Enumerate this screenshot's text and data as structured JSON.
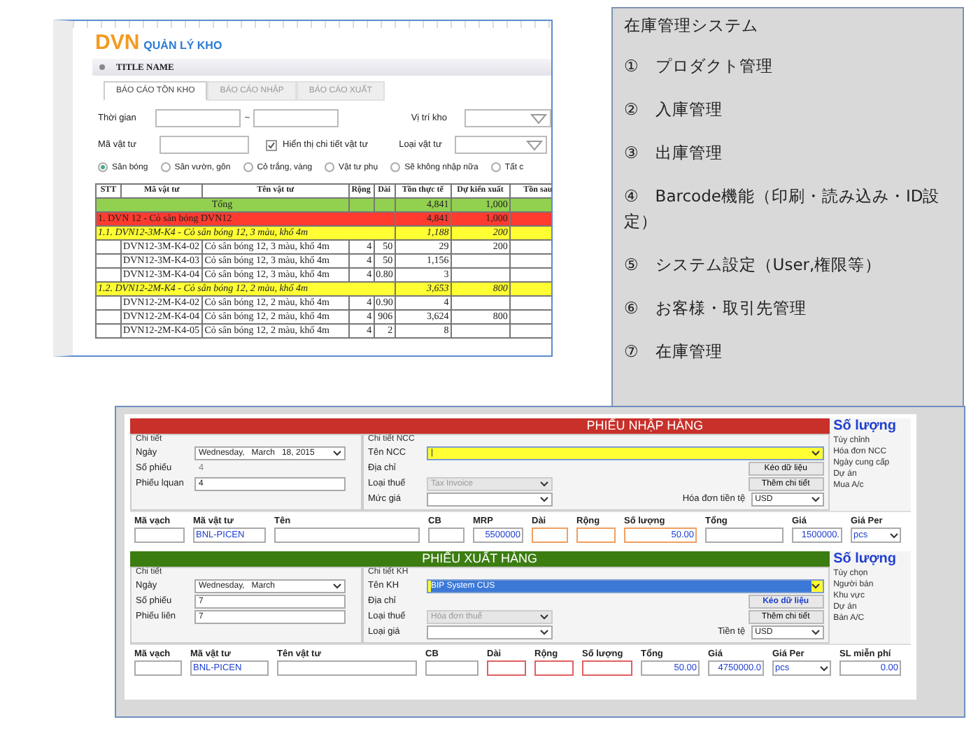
{
  "report_window": {
    "logo": {
      "brand": "DVN",
      "subtitle": "QUẢN LÝ KHO"
    },
    "title": "TITLE NAME",
    "tabs": [
      {
        "label": "BÁO CÁO TỒN KHO",
        "selected": true
      },
      {
        "label": "BÁO CÁO NHẬP",
        "selected": false
      },
      {
        "label": "BÁO CÁO XUẤT",
        "selected": false
      }
    ],
    "filters": {
      "time_label": "Thời gian",
      "range_separator": "~",
      "location_label": "Vị trí kho",
      "code_label": "Mã vật tư",
      "detail_checkbox": {
        "label": "Hiển thị chi tiết vật tư",
        "checked": true
      },
      "type_label": "Loại vật tư"
    },
    "categories": [
      {
        "label": "Sân bóng",
        "selected": true
      },
      {
        "label": "Sân vườn, gôn",
        "selected": false
      },
      {
        "label": "Cỏ trắng, vàng",
        "selected": false
      },
      {
        "label": "Vật tư phụ",
        "selected": false
      },
      {
        "label": "Sẽ không nhập nữa",
        "selected": false
      },
      {
        "label": "Tất c",
        "selected": false
      }
    ],
    "table": {
      "columns": [
        "STT",
        "Mã vật tư",
        "Tên vật tư",
        "Rộng",
        "Dài",
        "Tồn thực tế",
        "Dự kiến xuất",
        "Tồn sau"
      ],
      "rows": [
        {
          "kind": "total",
          "label": "Tổng",
          "stock": "4,841",
          "planned": "1,000"
        },
        {
          "kind": "group",
          "label": "1. DVN 12 - Cỏ sân bóng DVN12",
          "stock": "4,841",
          "planned": "1,000"
        },
        {
          "kind": "subgroup",
          "label": "1.1. DVN12-3M-K4 - Cỏ sân bóng 12, 3 màu, khổ 4m",
          "stock": "1,188",
          "planned": "200"
        },
        {
          "kind": "item",
          "code": "DVN12-3M-K4-02",
          "name": "Cỏ sân bóng 12, 3 màu, khổ 4m",
          "breadth": "4",
          "length": "50",
          "stock": "29",
          "planned": "200"
        },
        {
          "kind": "item",
          "code": "DVN12-3M-K4-03",
          "name": "Cỏ sân bóng 12, 3 màu, khổ 4m",
          "breadth": "4",
          "length": "50",
          "stock": "1,156"
        },
        {
          "kind": "item",
          "code": "DVN12-3M-K4-04",
          "name": "Cỏ sân bóng 12, 3 màu, khổ 4m",
          "breadth": "4",
          "length": "0.80",
          "stock": "3"
        },
        {
          "kind": "subgroup",
          "label": "1.2. DVN12-2M-K4 - Cỏ sân bóng 12, 2 màu, khổ 4m",
          "stock": "3,653",
          "planned": "800"
        },
        {
          "kind": "item",
          "code": "DVN12-2M-K4-02",
          "name": "Cỏ sân bóng 12, 2 màu, khổ 4m",
          "breadth": "4",
          "length": "0.90",
          "stock": "4"
        },
        {
          "kind": "item",
          "code": "DVN12-2M-K4-04",
          "name": "Cỏ sân bóng 12, 2 màu, khổ 4m",
          "breadth": "4",
          "length": "906",
          "stock": "3,624",
          "planned": "800"
        },
        {
          "kind": "item",
          "code": "DVN12-2M-K4-05",
          "name": "Cỏ sân bóng 12, 2 màu, khổ 4m",
          "breadth": "4",
          "length": "2",
          "stock": "8"
        }
      ]
    }
  },
  "notes": {
    "title": "在庫管理システム",
    "items": [
      "①　プロダクト管理",
      "②　入庫管理",
      "③　出庫管理",
      "④　Barcode機能（印刷・読み込み・ID設定）",
      "⑤　システム設定（User,権限等）",
      "⑥　お客様・取引先管理",
      "⑦　在庫管理"
    ]
  },
  "entry_window": {
    "forms": [
      {
        "kind": "import",
        "title": "PHIẾU NHẬP HÀNG",
        "side_title": "Số lượng",
        "side_labels": [
          "Tùy chỉnh",
          "Hóa đơn NCC",
          "Ngày cung cấp",
          "Dự án",
          "Mua A/c"
        ],
        "details": {
          "caption": "Chi tiết",
          "fields": [
            {
              "label": "Ngày",
              "value": "Wednesday,   March   18, 2015",
              "kind": "dropdown"
            },
            {
              "label": "Số phiếu",
              "value": "4",
              "kind": "static"
            },
            {
              "label": "Phiếu lquan",
              "value": "4",
              "kind": "text"
            }
          ]
        },
        "party": {
          "caption": "Chi tiết NCC",
          "fields": [
            {
              "label": "Tên NCC",
              "value": "|",
              "kind": "dropdown",
              "highlighted": true,
              "disabled": false
            },
            {
              "label": "Địa chỉ",
              "kind": "label"
            },
            {
              "label": "Loại thuế",
              "value": "Tax Invoice",
              "kind": "dropdown",
              "highlighted": false,
              "disabled": true
            },
            {
              "label": "Mức giá",
              "kind": "dropdown",
              "highlighted": false,
              "disabled": false
            }
          ]
        },
        "buttons": [
          {
            "label": "Kéo dữ liệu",
            "emphasis": false
          },
          {
            "label": "Thêm chi tiết",
            "emphasis": false
          }
        ],
        "currency": {
          "label": "Hóa đơn tiền tệ",
          "value": "USD"
        },
        "line_items": [
          {
            "label": "Mã vạch",
            "kind": "text",
            "required": false
          },
          {
            "label": "Mã vật tư",
            "value": "BNL-PICEN",
            "kind": "text",
            "required": false
          },
          {
            "label": "Tên",
            "kind": "text",
            "required": false
          },
          {
            "label": "CB",
            "kind": "text",
            "required": false
          },
          {
            "label": "MRP",
            "value": "5500000",
            "kind": "number",
            "required": false
          },
          {
            "label": "Dài",
            "kind": "text",
            "required": true
          },
          {
            "label": "Rộng",
            "kind": "text",
            "required": true
          },
          {
            "label": "Số lượng",
            "value": "50.00",
            "kind": "number",
            "required": true
          },
          {
            "label": "Tổng",
            "kind": "text",
            "required": false
          },
          {
            "label": "Giá",
            "value": "1500000.",
            "kind": "number",
            "required": false
          },
          {
            "label": "Giá Per",
            "value": "pcs",
            "kind": "dropdown",
            "required": false
          }
        ]
      },
      {
        "kind": "export",
        "title": "PHIẾU XUẤT HÀNG",
        "side_title": "Số lượng",
        "side_labels": [
          "Tùy chọn",
          "Người bán",
          "Khu vực",
          "Dự án",
          "Bán A/C"
        ],
        "details": {
          "caption": "Chi tiết",
          "fields": [
            {
              "label": "Ngày",
              "value": "Wednesday,   March",
              "kind": "dropdown"
            },
            {
              "label": "Số phiếu",
              "value": "7",
              "kind": "text"
            },
            {
              "label": "Phiếu liên",
              "value": "7",
              "kind": "text"
            }
          ]
        },
        "party": {
          "caption": "Chi tiết KH",
          "fields": [
            {
              "label": "Tên KH",
              "value": "BIP System CUS",
              "kind": "dropdown",
              "highlighted": true,
              "disabled": false
            },
            {
              "label": "Địa chỉ",
              "kind": "label"
            },
            {
              "label": "Loại thuế",
              "value": "Hóa đơn thuế",
              "kind": "dropdown",
              "highlighted": false,
              "disabled": true
            },
            {
              "label": "Loại giá",
              "kind": "dropdown",
              "highlighted": false,
              "disabled": false
            }
          ]
        },
        "buttons": [
          {
            "label": "Kéo dữ liệu",
            "emphasis": true
          },
          {
            "label": "Thêm chi tiết",
            "emphasis": false
          }
        ],
        "currency": {
          "label": "Tiền tệ",
          "value": "USD"
        },
        "line_items": [
          {
            "label": "Mã vạch",
            "kind": "text",
            "required": false
          },
          {
            "label": "Mã vật tư",
            "value": "BNL-PICEN",
            "kind": "text",
            "required": false
          },
          {
            "label": "Tên vật tư",
            "kind": "text",
            "required": false
          },
          {
            "label": "CB",
            "kind": "text",
            "required": false
          },
          {
            "label": "Dài",
            "kind": "text",
            "required": true
          },
          {
            "label": "Rộng",
            "kind": "text",
            "required": true
          },
          {
            "label": "Số lượng",
            "kind": "text",
            "required": true
          },
          {
            "label": "Tổng",
            "value": "50.00",
            "kind": "number",
            "required": false
          },
          {
            "label": "Giá",
            "value": "4750000.0",
            "kind": "number",
            "required": false
          },
          {
            "label": "Giá Per",
            "value": "pcs",
            "kind": "dropdown",
            "required": false
          },
          {
            "label": "SL miễn phí",
            "value": "0.00",
            "kind": "number",
            "required": false
          }
        ]
      }
    ]
  }
}
